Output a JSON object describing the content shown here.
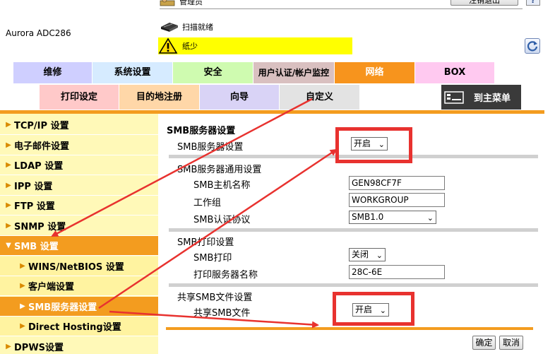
{
  "header": {
    "device_name": "Aurora ADC286",
    "admin_label": "管理员",
    "logout_label": "注销退出",
    "help_label": "?",
    "status_scan": "扫描就绪",
    "status_warning": "纸少"
  },
  "tabs_primary": [
    {
      "label": "维修",
      "bg": "#cfcfff"
    },
    {
      "label": "系统设置",
      "bg": "#d6ebff"
    },
    {
      "label": "安全",
      "bg": "#cffbb0"
    },
    {
      "label": "用户认证/帐户监控",
      "bg": "#d9c0c0"
    },
    {
      "label": "网络",
      "bg": "#f7941d",
      "active": true
    },
    {
      "label": "BOX",
      "bg": "#ffc9f0"
    }
  ],
  "tabs_secondary": [
    {
      "label": "打印设定",
      "bg": "#ffc9c9"
    },
    {
      "label": "目的地注册",
      "bg": "#ffd7a8"
    },
    {
      "label": "向导",
      "bg": "#d9d3f6"
    },
    {
      "label": "自定义",
      "bg": "#e3e3e3"
    }
  ],
  "main_menu_label": "到主菜单",
  "sidebar": {
    "items": [
      {
        "label": "TCP/IP 设置",
        "arrow": "▶",
        "state": "normal"
      },
      {
        "label": "电子邮件设置",
        "arrow": "▶",
        "state": "normal"
      },
      {
        "label": "LDAP 设置",
        "arrow": "▶",
        "state": "normal"
      },
      {
        "label": "IPP 设置",
        "arrow": "▶",
        "state": "normal"
      },
      {
        "label": "FTP 设置",
        "arrow": "▶",
        "state": "normal"
      },
      {
        "label": "SNMP 设置",
        "arrow": "▶",
        "state": "normal"
      },
      {
        "label": "SMB 设置",
        "arrow": "▼",
        "state": "active"
      },
      {
        "label": "WINS/NetBIOS 设置",
        "arrow": "▶",
        "state": "sub"
      },
      {
        "label": "客户端设置",
        "arrow": "▶",
        "state": "sub"
      },
      {
        "label": "SMB服务器设置",
        "arrow": "▶",
        "state": "sub-active"
      },
      {
        "label": "Direct Hosting设置",
        "arrow": "▶",
        "state": "sub"
      },
      {
        "label": "DPWS设置",
        "arrow": "▶",
        "state": "normal"
      }
    ]
  },
  "content": {
    "page_title": "SMB服务器设置",
    "server_setting": {
      "label": "SMB服务器设置",
      "value": "开启"
    },
    "common_section": {
      "title": "SMB服务器通用设置",
      "host_name": {
        "label": "SMB主机名称",
        "value": "GEN98CF7F"
      },
      "workgroup": {
        "label": "工作组",
        "value": "WORKGROUP"
      },
      "auth_protocol": {
        "label": "SMB认证协议",
        "value": "SMB1.0"
      }
    },
    "print_section": {
      "title": "SMB打印设置",
      "smb_print": {
        "label": "SMB打印",
        "value": "关闭"
      },
      "print_server_name": {
        "label": "打印服务器名称",
        "value": "28C-6E"
      }
    },
    "share_section": {
      "title": "共享SMB文件设置",
      "share_files": {
        "label": "共享SMB文件",
        "value": "开启"
      }
    },
    "ok_label": "确定",
    "cancel_label": "取消"
  },
  "colors": {
    "accent_orange": "#f39c1f",
    "sidebar_bg": "#fff9b8",
    "annotation_red": "#e8322f",
    "warning_yellow": "#ffff00"
  }
}
